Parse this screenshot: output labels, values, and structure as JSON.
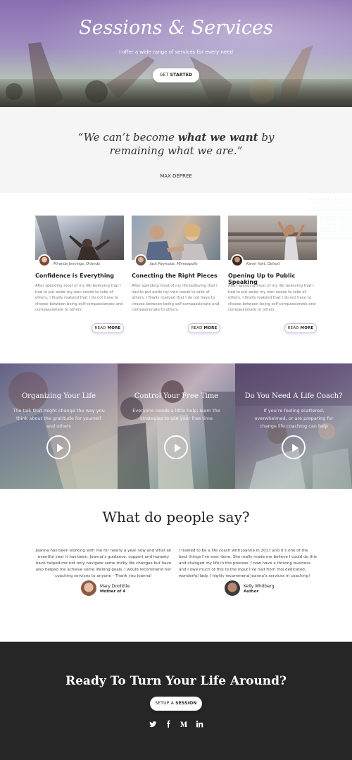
{
  "hero": {
    "title": "Sessions & Services",
    "subtitle": "I offer a wide range of services for every need",
    "cta_prefix": "GET ",
    "cta_bold": "STARTED"
  },
  "quote": {
    "text_before": "“We can’t become ",
    "text_bold": "what we want",
    "text_after": " by remaining what we are.”",
    "author": "MAX DEPREE"
  },
  "cards": [
    {
      "byline": "Miranda Jennings, Orlando",
      "title": "Confidence is Everything",
      "body": "After spending most of my life believing that I had to put aside my own needs to take of others, I finally realized that I do not have to choose between being self-compassionate and compassionate to others.",
      "button_prefix": "READ ",
      "button_bold": "MORE"
    },
    {
      "byline": "Jack Reynolds, Minneapolis",
      "title": "Conecting the Right Pieces",
      "body": "After spending most of my life believing that I had to put aside my own needs to take of others, I finally realized that I do not have to choose between being self-compassionate and compassionate to others.",
      "button_prefix": "READ ",
      "button_bold": "MORE"
    },
    {
      "byline": "Karen Hart, Detroit",
      "title": "Opening Up to Public Speaking",
      "body": "After spending most of my life believing that I had to put aside my own needs to take of others, I finally realized that I do not have to choose between being self-compassionate and compassionate to others.",
      "button_prefix": "READ ",
      "button_bold": "MORE"
    }
  ],
  "panels": [
    {
      "title": "Organizing Your Life",
      "body": "The talk that might change the way you think about the gratitude for yourself and others"
    },
    {
      "title": "Control Your Free Time",
      "body": "Everyone needs a little help; learn the strategies to use your free time"
    },
    {
      "title": "Do You Need A Life Coach?",
      "body": "If you’re feeling scattered, overwhelmed, or are preparing for change life coaching can help"
    }
  ],
  "testimonials": {
    "heading": "What do people say?",
    "items": [
      {
        "text": "Joanna has been working with me for nearly a year now and what an eventful year it has been. Joanna’s guidance, support and honesty have helped me not only navigate some tricky life changes but have also helped me achieve some lifelong goals. I would recommend her coaching services to anyone - Thank you Joanna!",
        "name": "Mary Doolittle",
        "role": "Mother of 4"
      },
      {
        "text": "I trained to be a life coach with Joanna in 2017 and it’s one of the best things I’ve ever done. She really made me believe I could do this and changed my life in the process. I now have a thriving business and I owe much of this to the input I’ve had from this dedicated, wonderful lady. I highly recommend Joanna’s services in coaching!",
        "name": "Kelly Whitberg",
        "role": "Author"
      }
    ]
  },
  "cta": {
    "heading": "Ready To Turn Your Life Around?",
    "button_prefix": "SETUP A ",
    "button_bold": "SESSION",
    "social": [
      "twitter-icon",
      "facebook-icon",
      "medium-icon",
      "linkedin-icon"
    ]
  }
}
